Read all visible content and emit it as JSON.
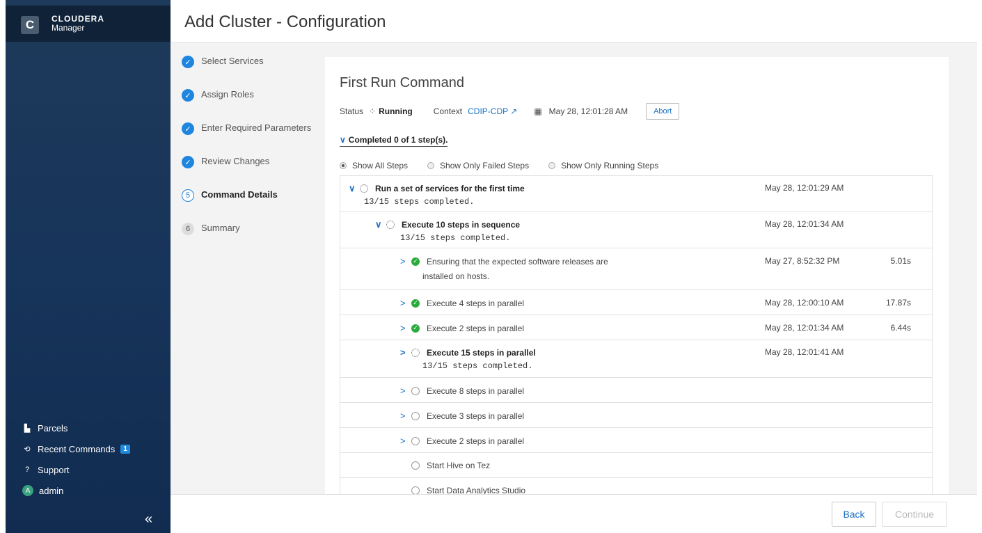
{
  "app": {
    "brand_name": "CLOUDERA",
    "brand_sub": "Manager",
    "logo_letter": "C"
  },
  "sidebar": {
    "items": [
      {
        "label": "Parcels",
        "icon": "parcels-icon"
      },
      {
        "label": "Recent Commands",
        "icon": "recent-commands-icon",
        "badge": "1"
      },
      {
        "label": "Support",
        "icon": "support-icon"
      },
      {
        "label": "admin",
        "icon": "avatar",
        "avatar_letter": "A"
      }
    ],
    "collapse_label": "«"
  },
  "header": {
    "title": "Add Cluster - Configuration"
  },
  "wizard": {
    "steps": [
      {
        "label": "Select Services",
        "state": "done",
        "marker": "✓"
      },
      {
        "label": "Assign Roles",
        "state": "done",
        "marker": "✓"
      },
      {
        "label": "Enter Required Parameters",
        "state": "done",
        "marker": "✓"
      },
      {
        "label": "Review Changes",
        "state": "done",
        "marker": "✓"
      },
      {
        "label": "Command Details",
        "state": "current",
        "marker": "5"
      },
      {
        "label": "Summary",
        "state": "pending",
        "marker": "6"
      }
    ]
  },
  "command": {
    "title": "First Run Command",
    "status_label": "Status",
    "status_value": "Running",
    "context_label": "Context",
    "context_value": "CDIP-CDP",
    "date": "May 28, 12:01:28 AM",
    "abort_label": "Abort",
    "completed_summary": "Completed 0 of 1 step(s).",
    "filters": [
      {
        "label": "Show All Steps",
        "selected": true
      },
      {
        "label": "Show Only Failed Steps",
        "selected": false
      },
      {
        "label": "Show Only Running Steps",
        "selected": false
      }
    ],
    "rows": [
      {
        "title": "Run a set of services for the first time",
        "sub": "13/15 steps completed.",
        "timestamp": "May 28, 12:01:29 AM",
        "duration": "",
        "status": "running",
        "level": 0,
        "chevron": "∨"
      },
      {
        "title": "Execute 10 steps in sequence",
        "sub": "13/15 steps completed.",
        "timestamp": "May 28, 12:01:34 AM",
        "duration": "",
        "status": "running",
        "level": 1,
        "chevron": "∨"
      },
      {
        "title": "Ensuring that the expected software releases are",
        "line2": "installed on hosts.",
        "timestamp": "May 27, 8:52:32 PM",
        "duration": "5.01s",
        "status": "success",
        "level": 2,
        "chevron": ">"
      },
      {
        "title": "Execute 4 steps in parallel",
        "timestamp": "May 28, 12:00:10 AM",
        "duration": "17.87s",
        "status": "success",
        "level": 2,
        "chevron": ">"
      },
      {
        "title": "Execute 2 steps in parallel",
        "timestamp": "May 28, 12:01:34 AM",
        "duration": "6.44s",
        "status": "success",
        "level": 2,
        "chevron": ">"
      },
      {
        "title": "Execute 15 steps in parallel",
        "sub": "13/15 steps completed.",
        "timestamp": "May 28, 12:01:41 AM",
        "duration": "",
        "status": "running",
        "level": 2,
        "chevron": ">"
      },
      {
        "title": "Execute 8 steps in parallel",
        "timestamp": "",
        "duration": "",
        "status": "pending",
        "level": 2,
        "chevron": ">"
      },
      {
        "title": "Execute 3 steps in parallel",
        "timestamp": "",
        "duration": "",
        "status": "pending",
        "level": 2,
        "chevron": ">"
      },
      {
        "title": "Execute 2 steps in parallel",
        "timestamp": "",
        "duration": "",
        "status": "pending",
        "level": 2,
        "chevron": ">"
      },
      {
        "title": "Start Hive on Tez",
        "timestamp": "",
        "duration": "",
        "status": "pending",
        "level": 2,
        "chevron": ""
      },
      {
        "title": "Start Data Analytics Studio",
        "timestamp": "",
        "duration": "",
        "status": "pending",
        "level": 2,
        "chevron": ""
      }
    ]
  },
  "footer": {
    "back_label": "Back",
    "continue_label": "Continue"
  },
  "colors": {
    "accent": "#1a6fc4",
    "success": "#2bab3c",
    "sidebar": "#17345a"
  }
}
